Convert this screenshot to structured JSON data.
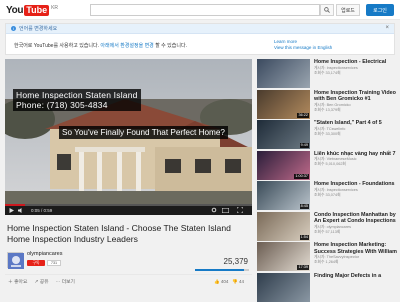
{
  "masthead": {
    "logo_you": "You",
    "logo_tube": "Tube",
    "logo_region": "KR",
    "upload_label": "업로드",
    "login_label": "로그인"
  },
  "notice": {
    "header": "언어를 변경하세요",
    "msg_prefix": "한국어로 YouTube를 사용하고 있습니다.",
    "msg_link": "아래에서 환경설정을 변경",
    "msg_suffix": "할 수 있습니다.",
    "learn_more": "Learn more",
    "view_english": "View this message in English"
  },
  "player": {
    "overlay_line1": "Home Inspection Staten Island",
    "overlay_line2": "Phone: (718) 305-4834",
    "overlay_question": "So You've Finally Found That Perfect Home?",
    "time": "0:05 / 0:59",
    "progress": 0.08
  },
  "video": {
    "title": "Home Inspection Staten Island - Choose The Staten Island Home Inspection Industry Leaders",
    "channel": "olympiancares",
    "subscribe_label": "구독",
    "subscriber_count": "731",
    "views": "25,379",
    "likes_fraction": 0.9,
    "like_count": "404",
    "dislike_count": "44",
    "action_like": "좋아요",
    "action_share": "공유",
    "action_more": "더보기"
  },
  "sidebar": [
    {
      "title": "Home Inspection - Electrical",
      "meta1": "게시자: Inspectionservices",
      "meta2": "조회수 33,174회",
      "duration": "",
      "colors": [
        "#3b4a5f",
        "#9aa5b0"
      ]
    },
    {
      "title": "Home Inspection Training Video with Ben Gromicko #1",
      "meta1": "게시자: Ben Gromicko",
      "meta2": "조회수 13,379회",
      "duration": "36:22",
      "colors": [
        "#4a3b2d",
        "#b38b5e"
      ]
    },
    {
      "title": "\"Staten Island,\" Part 4 of 5",
      "meta1": "게시자: TCswelinfo",
      "meta2": "조회수 33,300회",
      "duration": "9:49",
      "colors": [
        "#1e2b38",
        "#6d7a84"
      ]
    },
    {
      "title": "Liên khúc nhạc vàng hay nhất 7",
      "meta1": "게시자: VietnameseMusic",
      "meta2": "조회수 5,010,062회",
      "duration": "1:00:37",
      "colors": [
        "#2a1e3a",
        "#c06a8a"
      ]
    },
    {
      "title": "Home Inspection - Foundations",
      "meta1": "게시자: Inspectionservices",
      "meta2": "조회수 33,074회",
      "duration": "8:45",
      "colors": [
        "#3a4b58",
        "#bac4cc"
      ]
    },
    {
      "title": "Condo Inspection Manhattan by An Expert at Condo Inspections",
      "meta1": "게시자: olympiancares",
      "meta2": "조회수 57,113회",
      "duration": "1:54",
      "colors": [
        "#7a6a58",
        "#d9cfc0"
      ]
    },
    {
      "title": "Home Inspection Marketing: Success Strategies With William",
      "meta1": "게시자: TheSavvyInspector",
      "meta2": "조회수 1,264회",
      "duration": "17:39",
      "colors": [
        "#6b5d52",
        "#e3dcd2"
      ]
    },
    {
      "title": "Finding Major Defects in a",
      "meta1": "",
      "meta2": "",
      "duration": "",
      "colors": [
        "#2f3d4c",
        "#8a97a3"
      ]
    }
  ]
}
